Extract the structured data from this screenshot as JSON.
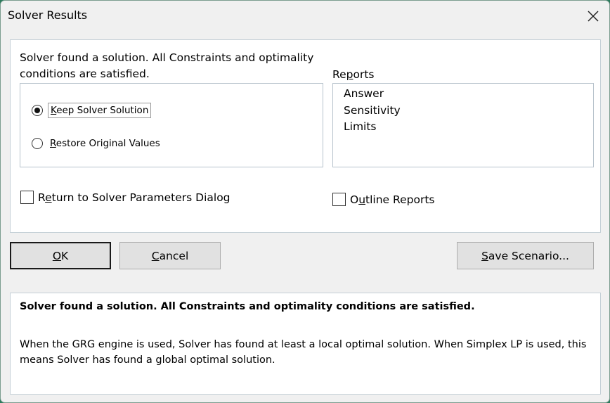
{
  "window": {
    "title": "Solver Results"
  },
  "main": {
    "status_message": "Solver found a solution.  All Constraints and optimality conditions are satisfied.",
    "options": [
      {
        "label": "Keep Solver Solution",
        "selected": true
      },
      {
        "label": "Restore Original Values",
        "selected": false
      }
    ],
    "reports_label": "Reports",
    "reports": [
      "Answer",
      "Sensitivity",
      "Limits"
    ],
    "return_checkbox": {
      "label": "Return to Solver Parameters Dialog",
      "checked": false
    },
    "outline_checkbox": {
      "label": "Outline Reports",
      "checked": false
    }
  },
  "buttons": {
    "ok": "OK",
    "cancel": "Cancel",
    "save_scenario": "Save Scenario..."
  },
  "info": {
    "headline": "Solver found a solution.  All Constraints and optimality conditions are satisfied.",
    "body": "When the GRG engine is used, Solver has found at least a local optimal solution. When Simplex LP is used, this means Solver has found a global optimal solution."
  }
}
